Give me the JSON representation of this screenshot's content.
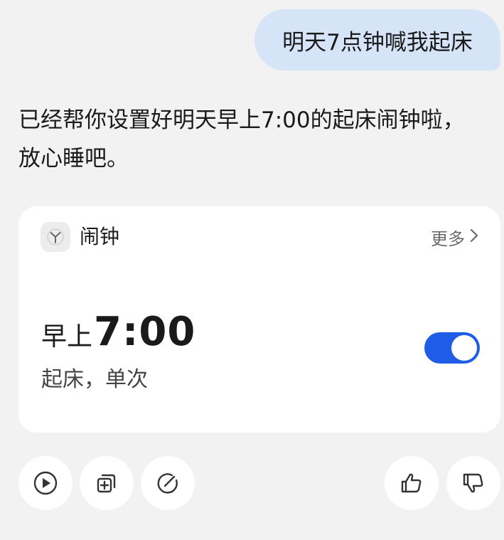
{
  "user_message": "明天7点钟喊我起床",
  "assistant_message": "已经帮你设置好明天早上7:00的起床闹钟啦，放心睡吧。",
  "alarm_card": {
    "app_icon": "clock-app-icon",
    "title": "闹钟",
    "more_label": "更多",
    "more_icon": "chevron-right-icon",
    "period": "早上",
    "time": "7:00",
    "detail": "起床，单次",
    "enabled": true,
    "toggle_color": "#1f5de6"
  },
  "actions": {
    "left": [
      {
        "icon": "play-icon"
      },
      {
        "icon": "add-copy-icon"
      },
      {
        "icon": "edit-icon"
      }
    ],
    "right": [
      {
        "icon": "thumbs-up-icon"
      },
      {
        "icon": "thumbs-down-icon"
      }
    ]
  }
}
